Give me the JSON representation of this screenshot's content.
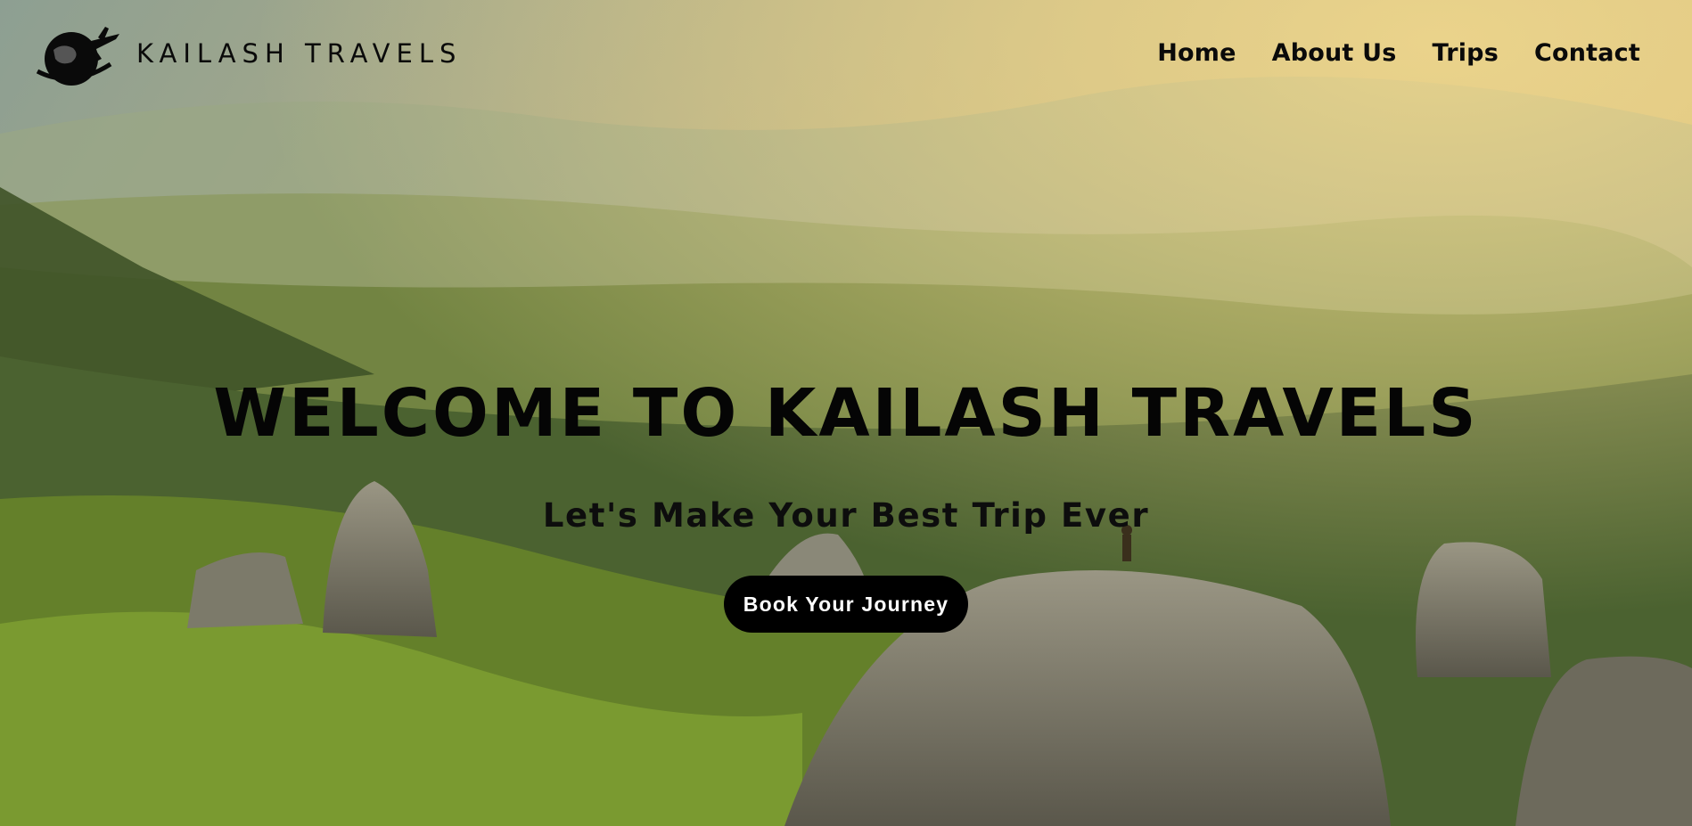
{
  "brand": {
    "name": "KAILASH TRAVELS",
    "logo_icon": "globe-airplane-icon"
  },
  "nav": {
    "items": [
      {
        "label": "Home"
      },
      {
        "label": "About Us"
      },
      {
        "label": "Trips"
      },
      {
        "label": "Contact"
      }
    ]
  },
  "hero": {
    "title": "WELCOME TO KAILASH TRAVELS",
    "subtitle": "Let's Make Your Best Trip Ever",
    "cta_label": "Book Your Journey",
    "background": "mountain-landscape-hiker-on-rock"
  },
  "colors": {
    "text": "#050505",
    "button_bg": "#000000",
    "button_text": "#ffffff"
  }
}
